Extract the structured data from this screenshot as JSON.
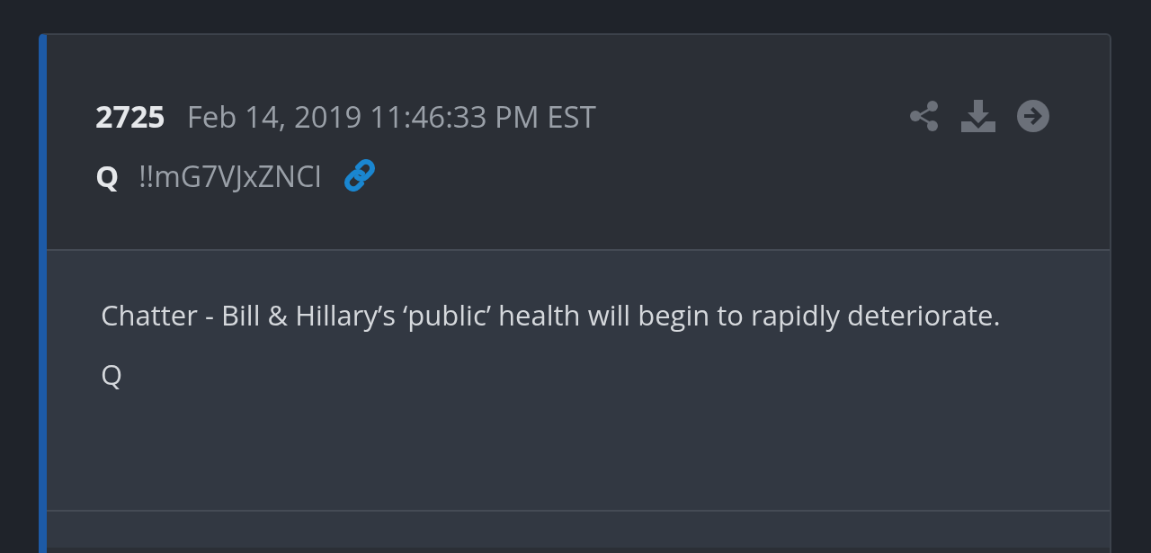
{
  "post": {
    "number": "2725",
    "timestamp": "Feb 14, 2019 11:46:33 PM EST",
    "author": "Q",
    "tripcode": "!!mG7VJxZNCI",
    "paragraphs": [
      "Chatter - Bill & Hillary’s ‘public’ health will begin to rapidly deteriorate.",
      "Q"
    ]
  }
}
